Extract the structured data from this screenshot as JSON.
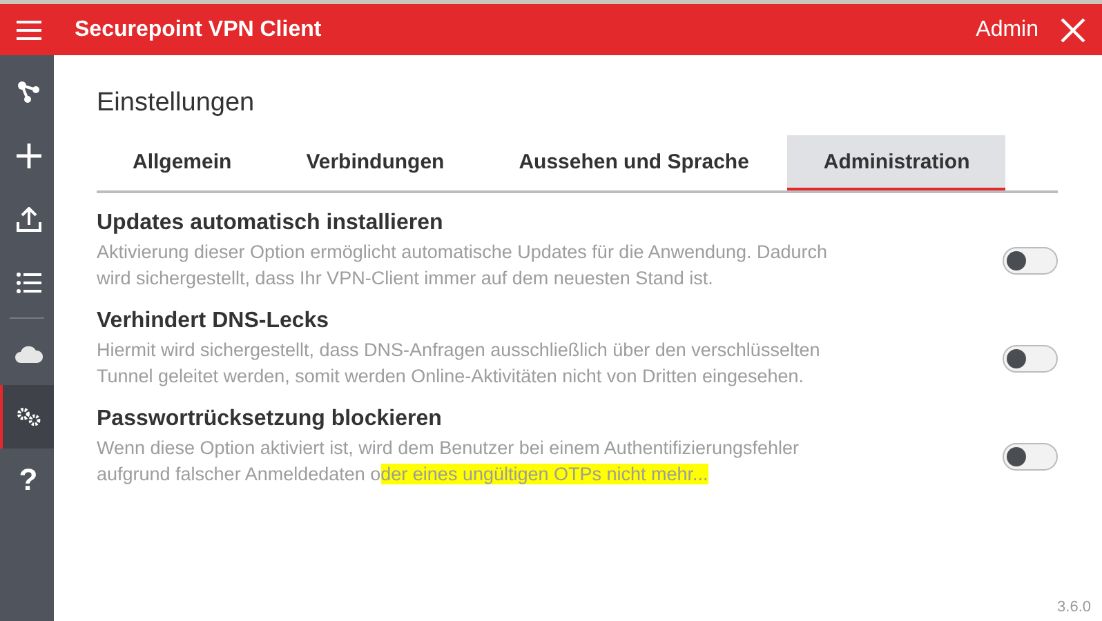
{
  "header": {
    "title": "Securepoint VPN Client",
    "user": "Admin"
  },
  "sidebar": {
    "items": [
      {
        "kind": "network",
        "selected": false
      },
      {
        "kind": "plus",
        "selected": false
      },
      {
        "kind": "upload",
        "selected": false
      },
      {
        "kind": "list",
        "selected": false
      },
      {
        "kind": "divider"
      },
      {
        "kind": "cloud",
        "selected": false
      },
      {
        "kind": "gears",
        "selected": true
      },
      {
        "kind": "help",
        "symbol": "?",
        "selected": false
      }
    ]
  },
  "page_title": "Einstellungen",
  "tabs": [
    {
      "label": "Allgemein",
      "selected": false
    },
    {
      "label": "Verbindungen",
      "selected": false
    },
    {
      "label": "Aussehen und Sprache",
      "selected": false
    },
    {
      "label": "Administration",
      "selected": true
    }
  ],
  "settings": [
    {
      "title": "Updates automatisch installieren",
      "description": "Aktivierung dieser Option ermöglicht automatische Updates für die Anwendung. Dadurch wird sichergestellt, dass Ihr VPN-Client immer auf dem neuesten Stand ist.",
      "on": false
    },
    {
      "title": "Verhindert DNS-Lecks",
      "description": "Hiermit wird sichergestellt, dass DNS-Anfragen ausschließlich über den verschlüsselten Tunnel geleitet werden, somit werden Online-Aktivitäten nicht von Dritten eingesehen.",
      "on": false
    },
    {
      "title": "Passwortrücksetzung blockieren",
      "description": "Wenn diese Option aktiviert ist, wird dem Benutzer bei einem Authentifizierungsfehler aufgrund falscher Anmeldedaten o",
      "highlighted": "der eines ungültigen OTPs nicht mehr...",
      "on": false
    }
  ],
  "version": "3.6.0"
}
